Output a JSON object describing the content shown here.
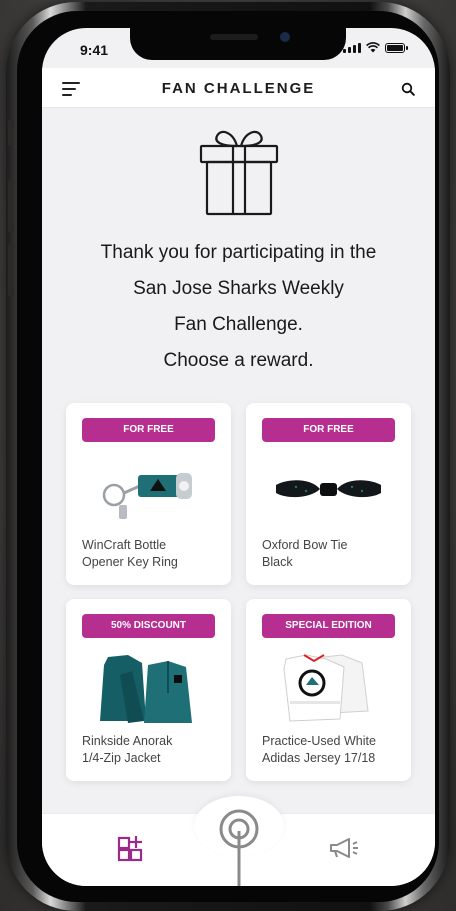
{
  "status_bar": {
    "time": "9:41"
  },
  "header": {
    "title": "FAN CHALLENGE"
  },
  "intro": {
    "lines": [
      "Thank you for participating in the",
      "San Jose Sharks Weekly",
      "Fan Challenge.",
      "Choose a reward."
    ]
  },
  "rewards": [
    {
      "badge": "FOR FREE",
      "name_line1": "WinCraft Bottle",
      "name_line2": "Opener Key Ring",
      "icon": "key-ring-icon"
    },
    {
      "badge": "FOR FREE",
      "name_line1": "Oxford Bow Tie",
      "name_line2": "Black",
      "icon": "bow-tie-icon"
    },
    {
      "badge": "50% DISCOUNT",
      "name_line1": "Rinkside Anorak",
      "name_line2": "1/4-Zip Jacket",
      "icon": "jacket-icon"
    },
    {
      "badge": "SPECIAL EDITION",
      "name_line1": "Practice-Used White",
      "name_line2": "Adidas Jersey 17/18",
      "icon": "jersey-icon"
    }
  ],
  "bottom_nav": {
    "items": [
      "grid-add-icon",
      "radio-broadcast-icon",
      "megaphone-icon"
    ]
  },
  "colors": {
    "accent": "#b62e8f",
    "background": "#f1f1f3",
    "teal": "#1e6f76"
  }
}
